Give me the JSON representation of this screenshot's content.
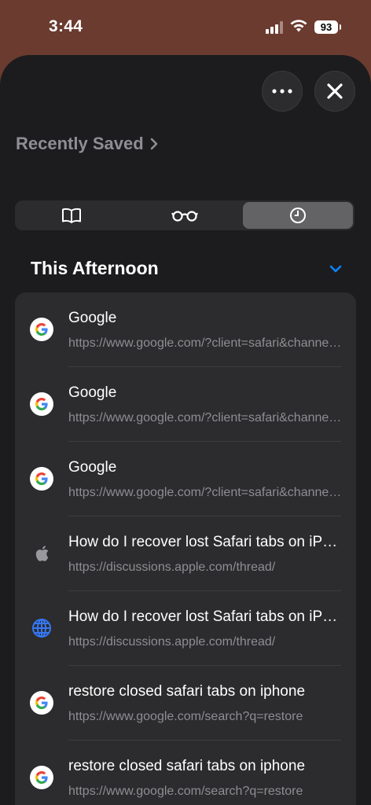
{
  "status": {
    "time": "3:44",
    "battery": "93"
  },
  "header": {
    "recently_saved_label": "Recently Saved"
  },
  "tabs": [
    {
      "icon": "book-icon",
      "active": false
    },
    {
      "icon": "reading-glasses-icon",
      "active": false
    },
    {
      "icon": "clock-icon",
      "active": true
    }
  ],
  "section": {
    "title": "This Afternoon"
  },
  "history": [
    {
      "icon": "google-icon",
      "title": "Google",
      "url": "https://www.google.com/?client=safari&channel=iphone_bm"
    },
    {
      "icon": "google-icon",
      "title": "Google",
      "url": "https://www.google.com/?client=safari&channel=iphone_bm"
    },
    {
      "icon": "google-icon",
      "title": "Google",
      "url": "https://www.google.com/?client=safari&channel=iphone_bm"
    },
    {
      "icon": "apple-icon",
      "title": "How do I recover lost Safari tabs on iPhone",
      "url": "https://discussions.apple.com/thread/"
    },
    {
      "icon": "globe-icon",
      "title": "How do I recover lost Safari tabs on iPhone",
      "url": "https://discussions.apple.com/thread/"
    },
    {
      "icon": "google-icon",
      "title": "restore closed safari tabs on iphone",
      "url": "https://www.google.com/search?q=restore"
    },
    {
      "icon": "google-icon",
      "title": "restore closed safari tabs on iphone",
      "url": "https://www.google.com/search?q=restore"
    }
  ],
  "colors": {
    "accent": "#0a84ff",
    "sheet_bg": "#1c1c1e",
    "row_bg": "#2c2c2e",
    "status_bg": "#6b3b2f"
  }
}
